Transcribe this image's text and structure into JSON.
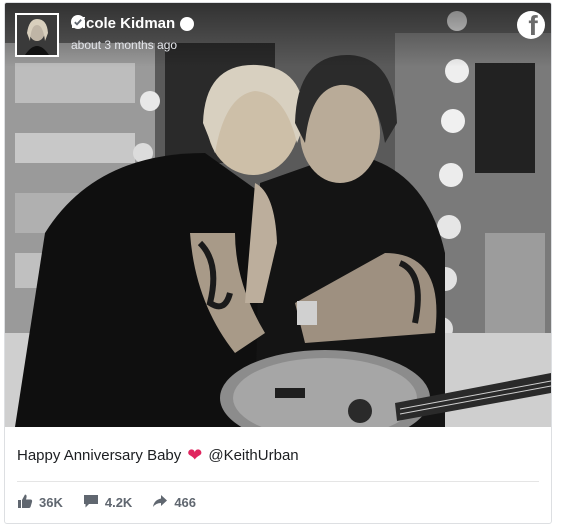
{
  "post": {
    "page_name": "Nicole Kidman",
    "timestamp": "about 3 months ago",
    "caption_text": "Happy Anniversary Baby",
    "caption_emoji": "❤️",
    "caption_mention": "@KeithUrban",
    "image_alt": "Black and white photo of a couple embracing with a guitar",
    "photo_style": "black-and-white"
  },
  "stats": {
    "likes": "36K",
    "comments": "4.2K",
    "shares": "466"
  },
  "icons": {
    "brand": "facebook-icon",
    "verified": "verified-check-icon",
    "like": "thumbs-up-icon",
    "comment": "comment-bubble-icon",
    "share": "share-arrow-icon"
  },
  "colors": {
    "text": "#1c1e21",
    "muted": "#606770",
    "heart": "#e0245e",
    "border": "#dddfe2"
  }
}
